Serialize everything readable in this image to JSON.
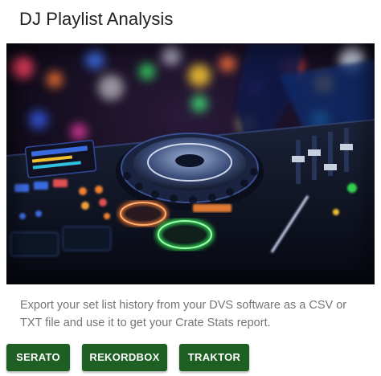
{
  "card": {
    "title": "DJ Playlist Analysis",
    "image_alt": "DJ controller with glowing jog wheel in a nightclub",
    "description": "Export your set list history from your DVS software as a CSV or TXT file and use it to get your Crate Stats report."
  },
  "actions": {
    "serato_label": "SERATO",
    "rekordbox_label": "REKORDBOX",
    "traktor_label": "TRAKTOR"
  },
  "colors": {
    "button_bg": "#1e5f24",
    "button_text": "#ffffff",
    "title": "#212121",
    "description": "#757575"
  }
}
